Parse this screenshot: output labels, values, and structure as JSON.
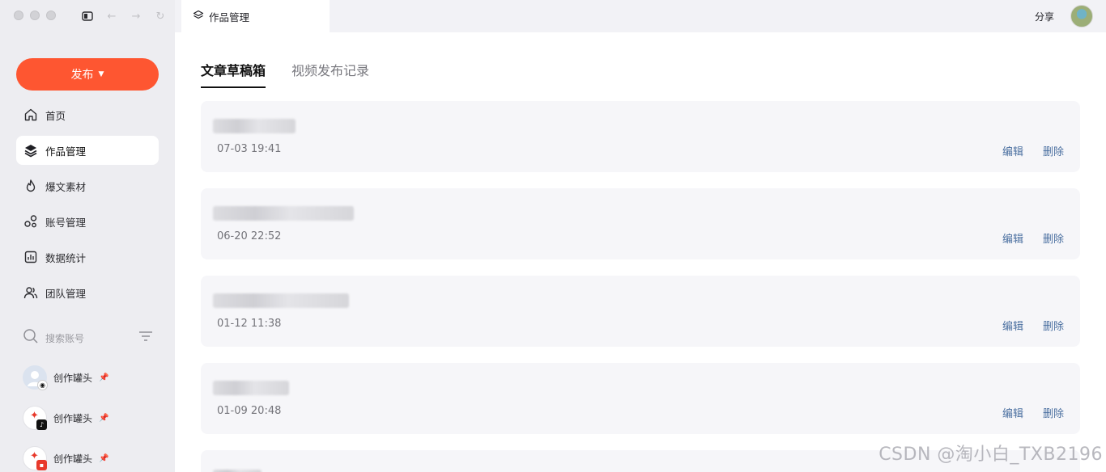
{
  "window": {
    "tab_title": "作品管理"
  },
  "sidebar": {
    "publish_label": "发布",
    "nav": [
      {
        "label": "首页",
        "icon": "home-icon"
      },
      {
        "label": "作品管理",
        "icon": "layers-icon",
        "active": true
      },
      {
        "label": "爆文素材",
        "icon": "fire-icon"
      },
      {
        "label": "账号管理",
        "icon": "accounts-icon"
      },
      {
        "label": "数据统计",
        "icon": "chart-icon"
      },
      {
        "label": "团队管理",
        "icon": "team-icon"
      }
    ],
    "search_placeholder": "搜索账号",
    "accounts": [
      {
        "name": "创作罐头"
      },
      {
        "name": "创作罐头"
      },
      {
        "name": "创作罐头"
      }
    ]
  },
  "topbar": {
    "share_label": "分享"
  },
  "main": {
    "tabs": [
      {
        "label": "文章草稿箱",
        "active": true
      },
      {
        "label": "视频发布记录",
        "active": false
      }
    ],
    "drafts": [
      {
        "date": "07-03 19:41",
        "edit": "编辑",
        "delete": "删除"
      },
      {
        "date": "06-20 22:52",
        "edit": "编辑",
        "delete": "删除"
      },
      {
        "date": "01-12 11:38",
        "edit": "编辑",
        "delete": "删除"
      },
      {
        "date": "01-09 20:48",
        "edit": "编辑",
        "delete": "删除"
      }
    ]
  },
  "watermark": "CSDN @淘小白_TXB2196"
}
